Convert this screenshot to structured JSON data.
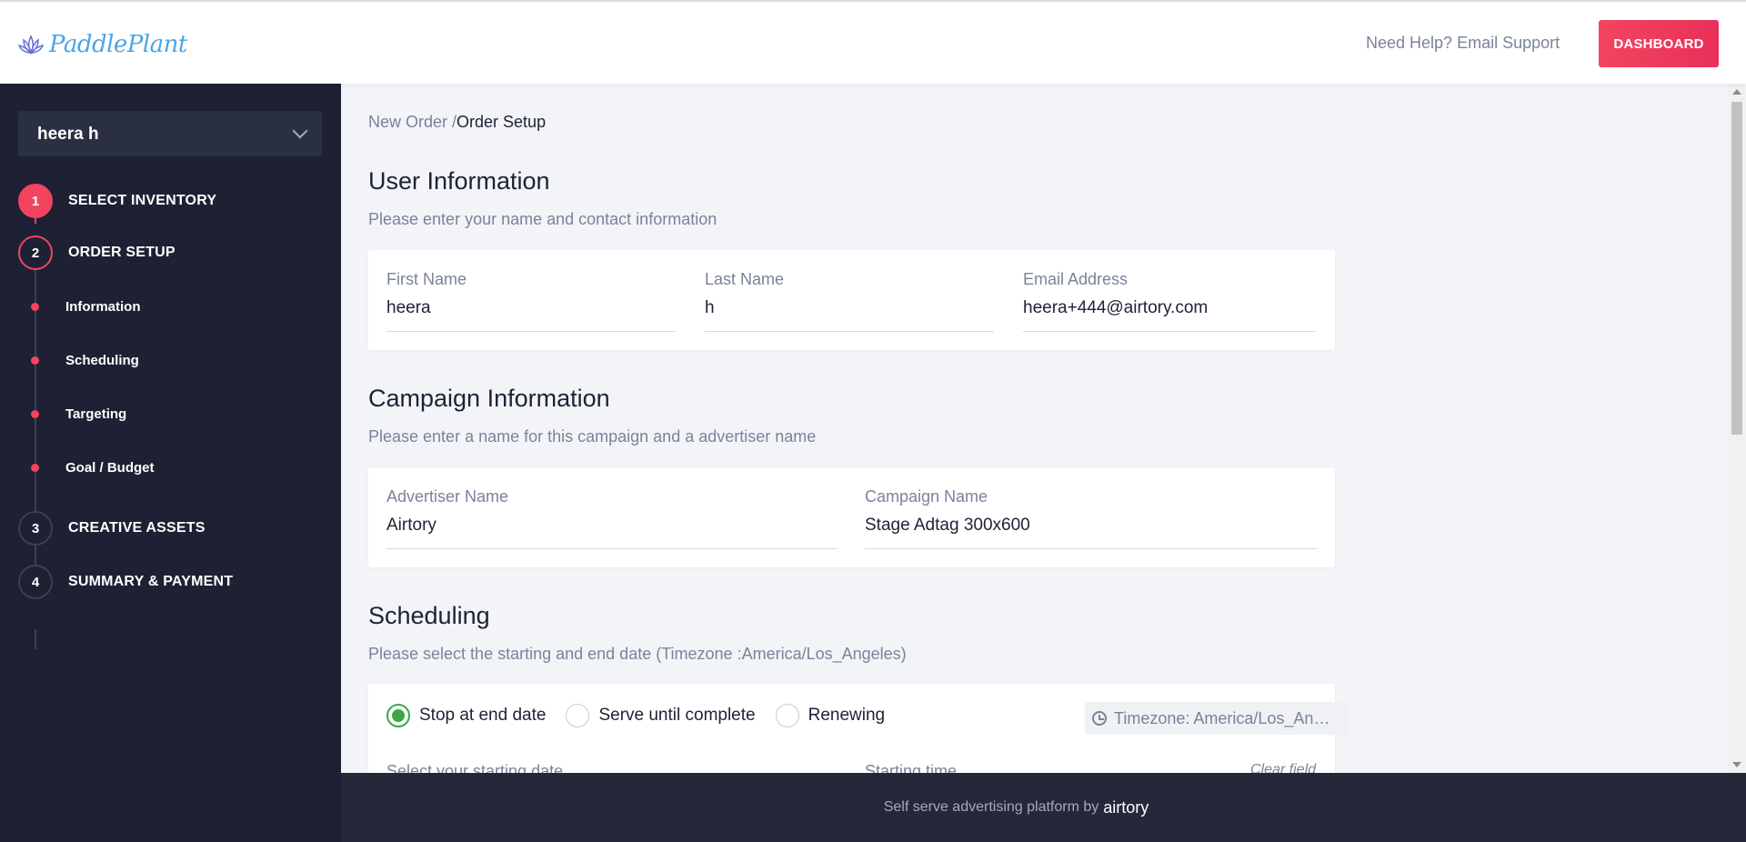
{
  "header": {
    "logo_text": "PaddlePlant",
    "help_text": "Need Help? Email Support",
    "dashboard_button": "DASHBOARD"
  },
  "sidebar": {
    "account_name": "heera h",
    "steps": [
      {
        "num": "1",
        "label": "SELECT INVENTORY",
        "state": "done"
      },
      {
        "num": "2",
        "label": "ORDER SETUP",
        "state": "current"
      },
      {
        "num": "3",
        "label": "CREATIVE ASSETS",
        "state": "pending"
      },
      {
        "num": "4",
        "label": "SUMMARY & PAYMENT",
        "state": "pending"
      }
    ],
    "substeps": [
      "Information",
      "Scheduling",
      "Targeting",
      "Goal / Budget"
    ]
  },
  "breadcrumb": {
    "parent": "New Order /",
    "current": "Order Setup"
  },
  "user_info": {
    "title": "User Information",
    "subtitle": "Please enter your name and contact information",
    "first_name_label": "First Name",
    "first_name_value": "heera",
    "last_name_label": "Last Name",
    "last_name_value": "h",
    "email_label": "Email Address",
    "email_value": "heera+444@airtory.com"
  },
  "campaign_info": {
    "title": "Campaign Information",
    "subtitle": "Please enter a name for this campaign and a advertiser name",
    "advertiser_label": "Advertiser Name",
    "advertiser_value": "Airtory",
    "campaign_label": "Campaign Name",
    "campaign_value": "Stage Adtag 300x600"
  },
  "scheduling": {
    "title": "Scheduling",
    "subtitle": "Please select the starting and end date (Timezone :America/Los_Angeles)",
    "options": [
      "Stop at end date",
      "Serve until complete",
      "Renewing"
    ],
    "selected": "Stop at end date",
    "timezone_chip": "Timezone: America/Los_Angeles",
    "start_date_label": "Select your starting date",
    "start_time_label": "Starting time",
    "clear_field": "Clear field"
  },
  "footer": {
    "text": "Self serve advertising platform by",
    "brand": "airtory"
  },
  "colors": {
    "accent": "#f2445f",
    "sidebar_bg": "#1d2133",
    "radio_on": "#3aa845",
    "logo": "#4aa6e8"
  }
}
